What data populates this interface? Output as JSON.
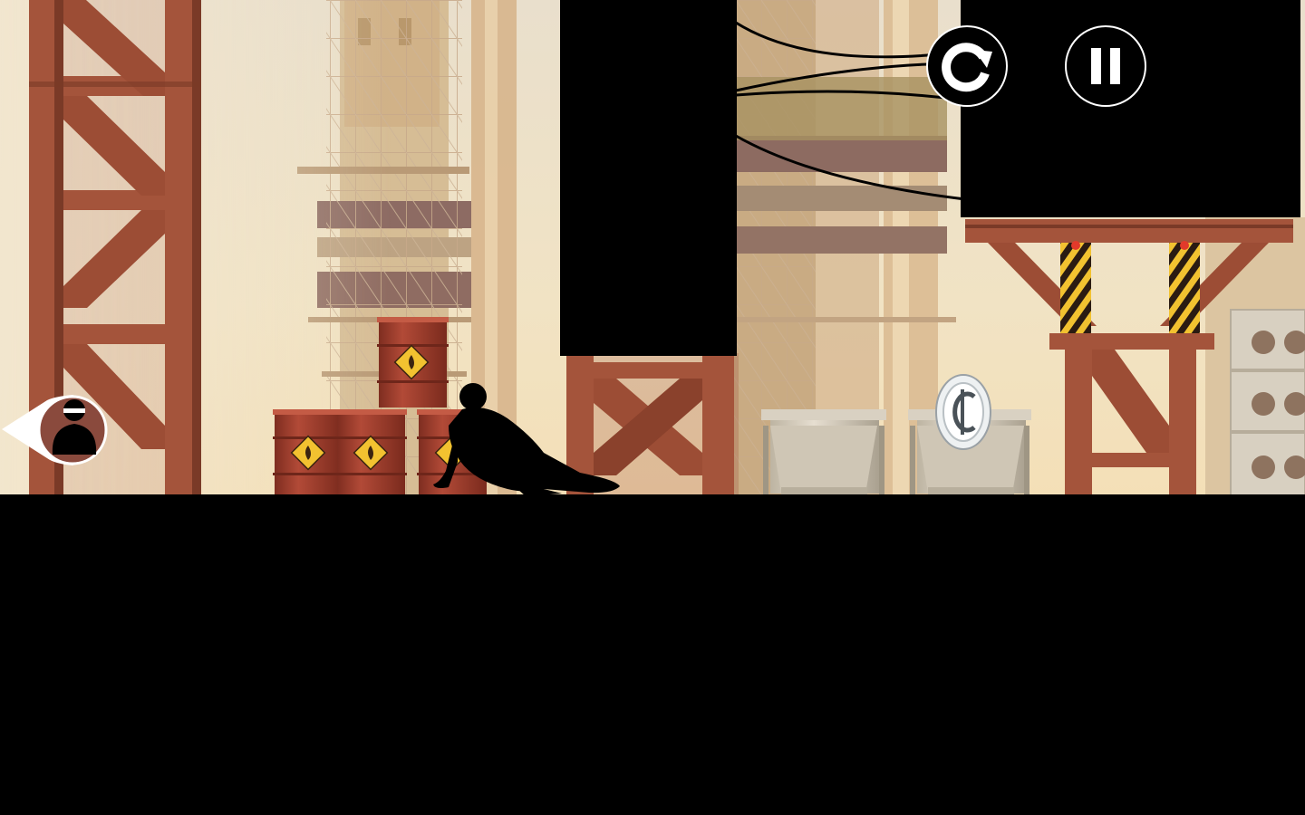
{
  "game": {
    "scene": "construction-site",
    "hud": {
      "restart_icon": "restart-icon",
      "pause_icon": "pause-icon",
      "chaser_indicator_icon": "chaser-indicator-icon"
    },
    "items": {
      "coin_icon": "coin-icon",
      "barrel_icon": "flammable-barrel-icon"
    }
  },
  "colors": {
    "sky_top": "#e6dcc9",
    "sky_bottom": "#f3e4c4",
    "steel_rust": "#a4543b",
    "steel_shadow": "#6e3525",
    "barrel_red": "#a03b2c",
    "hazard_yellow": "#f2c230",
    "silhouette": "#000000",
    "hud_white": "#ffffff"
  }
}
